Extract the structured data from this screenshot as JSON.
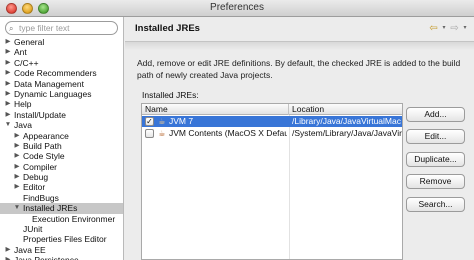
{
  "window": {
    "title": "Preferences"
  },
  "filter": {
    "placeholder": "type filter text"
  },
  "tree": [
    {
      "label": "General",
      "level": 0,
      "arrow": "right",
      "selected": false
    },
    {
      "label": "Ant",
      "level": 0,
      "arrow": "right",
      "selected": false
    },
    {
      "label": "C/C++",
      "level": 0,
      "arrow": "right",
      "selected": false
    },
    {
      "label": "Code Recommenders",
      "level": 0,
      "arrow": "right",
      "selected": false
    },
    {
      "label": "Data Management",
      "level": 0,
      "arrow": "right",
      "selected": false
    },
    {
      "label": "Dynamic Languages",
      "level": 0,
      "arrow": "right",
      "selected": false
    },
    {
      "label": "Help",
      "level": 0,
      "arrow": "right",
      "selected": false
    },
    {
      "label": "Install/Update",
      "level": 0,
      "arrow": "right",
      "selected": false
    },
    {
      "label": "Java",
      "level": 0,
      "arrow": "down",
      "selected": false
    },
    {
      "label": "Appearance",
      "level": 1,
      "arrow": "right",
      "selected": false
    },
    {
      "label": "Build Path",
      "level": 1,
      "arrow": "right",
      "selected": false
    },
    {
      "label": "Code Style",
      "level": 1,
      "arrow": "right",
      "selected": false
    },
    {
      "label": "Compiler",
      "level": 1,
      "arrow": "right",
      "selected": false
    },
    {
      "label": "Debug",
      "level": 1,
      "arrow": "right",
      "selected": false
    },
    {
      "label": "Editor",
      "level": 1,
      "arrow": "right",
      "selected": false
    },
    {
      "label": "FindBugs",
      "level": 1,
      "arrow": "none",
      "selected": false
    },
    {
      "label": "Installed JREs",
      "level": 1,
      "arrow": "down",
      "selected": true
    },
    {
      "label": "Execution Environmer",
      "level": 2,
      "arrow": "none",
      "selected": false
    },
    {
      "label": "JUnit",
      "level": 1,
      "arrow": "none",
      "selected": false
    },
    {
      "label": "Properties Files Editor",
      "level": 1,
      "arrow": "none",
      "selected": false
    },
    {
      "label": "Java EE",
      "level": 0,
      "arrow": "right",
      "selected": false
    },
    {
      "label": "Java Persistence",
      "level": 0,
      "arrow": "right",
      "selected": false
    }
  ],
  "page": {
    "title": "Installed JREs",
    "description": "Add, remove or edit JRE definitions. By default, the checked JRE is added to the build path of newly created Java projects.",
    "installed_label": "Installed JREs:"
  },
  "nav": {
    "back_icon": "back-arrow-icon",
    "forward_icon": "forward-arrow-icon"
  },
  "table": {
    "columns": {
      "name": "Name",
      "location": "Location"
    },
    "rows": [
      {
        "checked": true,
        "name": "JVM 7",
        "location": "/Library/Java/JavaVirtualMac",
        "selected": true
      },
      {
        "checked": false,
        "name": "JVM Contents (MacOS X Default)",
        "location": "/System/Library/Java/JavaVir",
        "selected": false
      }
    ]
  },
  "buttons": {
    "add": "Add...",
    "edit": "Edit...",
    "duplicate": "Duplicate...",
    "remove": "Remove",
    "search": "Search..."
  },
  "colors": {
    "selection": "#3875d7",
    "tree_selection": "#c7c7c7"
  }
}
